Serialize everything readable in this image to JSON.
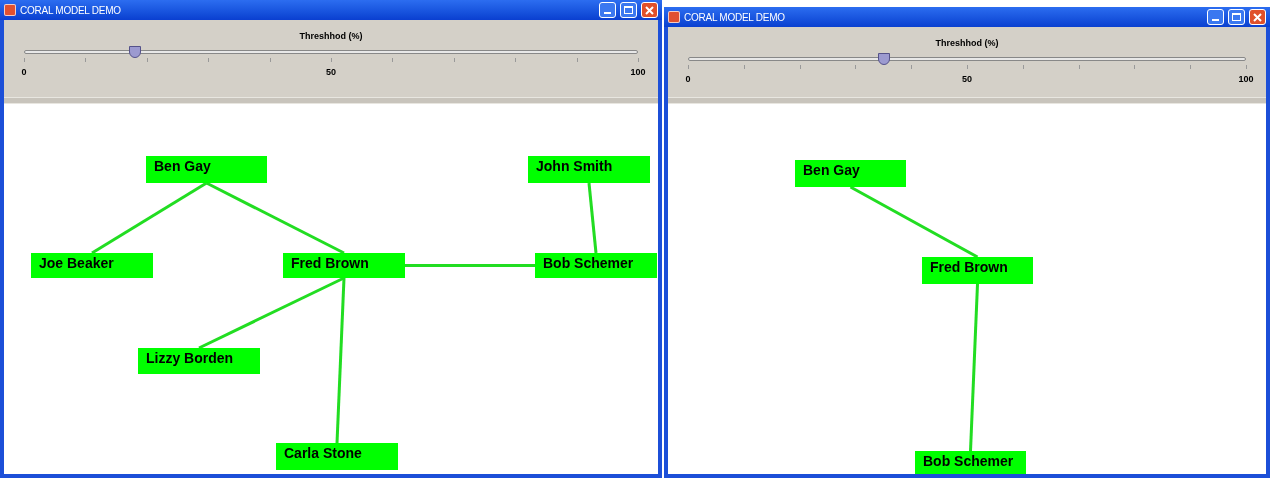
{
  "windows": [
    {
      "title": "CORAL MODEL DEMO",
      "slider": {
        "label": "Threshhod (%)",
        "level": 0.18,
        "tick_labels": [
          "0",
          "50",
          "100"
        ]
      },
      "graph": {
        "nodes": [
          "Ben Gay",
          "John Smith",
          "Joe Beaker",
          "Fred Brown",
          "Bob Schemer",
          "Lizzy Borden",
          "Carla Stone"
        ]
      }
    },
    {
      "title": "CORAL MODEL DEMO",
      "slider": {
        "label": "Threshhod (%)",
        "level": 0.35,
        "tick_labels": [
          "0",
          "50",
          "100"
        ]
      },
      "graph": {
        "nodes": [
          "Ben Gay",
          "Fred Brown",
          "Bob Schemer"
        ]
      }
    }
  ]
}
